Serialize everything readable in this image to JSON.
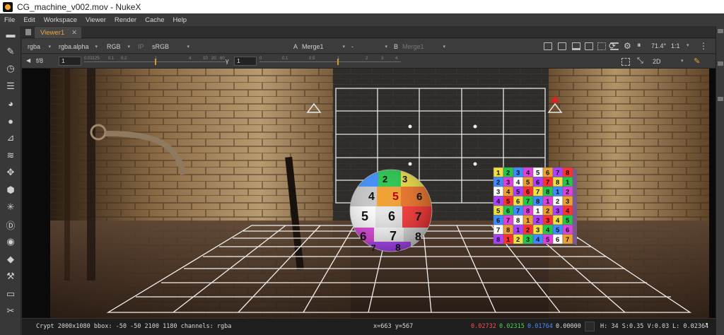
{
  "window": {
    "title": "CG_machine_v002.mov - NukeX"
  },
  "menu": [
    "File",
    "Edit",
    "Workspace",
    "Viewer",
    "Render",
    "Cache",
    "Help"
  ],
  "tab": {
    "label": "Viewer1",
    "close": "✕"
  },
  "viewer_toolbar": {
    "layer": "rgba",
    "alpha_channel": "rgba.alpha",
    "display": "RGB",
    "ip": "IP",
    "lut": "sRGB",
    "input_a_label": "A",
    "input_a": "Merge1",
    "composite": "-",
    "input_b_label": "B",
    "input_b": "Merge1",
    "zoom": "71.4°",
    "ratio": "1:1",
    "view_mode": "2D"
  },
  "exposure_bar": {
    "fstop": "f/8",
    "gain_value": "1",
    "gamma_label": "γ",
    "gamma_value": "1",
    "gain_ticks": [
      "0.03125",
      "0.1",
      "0.2",
      "1",
      "4",
      "10",
      "20",
      "60"
    ],
    "gamma_ticks": [
      "0",
      "0.1",
      "0.5",
      "1",
      "2",
      "3",
      "4"
    ]
  },
  "status": {
    "info": "Crypt 2000x1080  bbox: -50 -50 2100 1180 channels: rgba",
    "coords": "x=663 y=567",
    "r": "0.02732",
    "g": "0.02315",
    "b": "0.01764",
    "a": "0.00000",
    "hsv": "H: 34 S:0.35 V:0.03",
    "lum": "L: 0.02364"
  },
  "colors": {
    "accent": "#f0a33a",
    "status_r": "#ff4d4d",
    "status_g": "#4dd24d",
    "status_b": "#4d8cff"
  },
  "scene": {
    "sphere_numbers": [
      "2",
      "3",
      "4",
      "5",
      "6",
      "5",
      "6",
      "7",
      "6",
      "7",
      "8",
      "7",
      "8"
    ],
    "cube_rows": [
      [
        "1",
        "2",
        "3",
        "4",
        "5",
        "6",
        "7",
        "8"
      ],
      [
        "2",
        "3",
        "4",
        "5",
        "6",
        "7",
        "8",
        "1"
      ],
      [
        "3",
        "4",
        "5",
        "6",
        "7",
        "8",
        "1",
        "2"
      ],
      [
        "4",
        "5",
        "6",
        "7",
        "8",
        "1",
        "2",
        "3"
      ],
      [
        "5",
        "6",
        "7",
        "8",
        "1",
        "2",
        "3",
        "4"
      ],
      [
        "6",
        "7",
        "8",
        "1",
        "2",
        "3",
        "4",
        "5"
      ],
      [
        "7",
        "8",
        "1",
        "2",
        "3",
        "4",
        "5",
        "6"
      ],
      [
        "8",
        "1",
        "2",
        "3",
        "4",
        "5",
        "6",
        "7"
      ]
    ]
  },
  "icons": {
    "left_toolbar": [
      "viewer-tool-icon",
      "paint-icon",
      "time-icon",
      "channel-icon",
      "color-icon",
      "circle-icon",
      "filter-icon",
      "layers-icon",
      "transform-icon",
      "3d-icon",
      "particles-icon",
      "deep-icon",
      "views-icon",
      "metadata-icon",
      "toolsets-icon",
      "other-icon",
      "misc-icon"
    ]
  }
}
